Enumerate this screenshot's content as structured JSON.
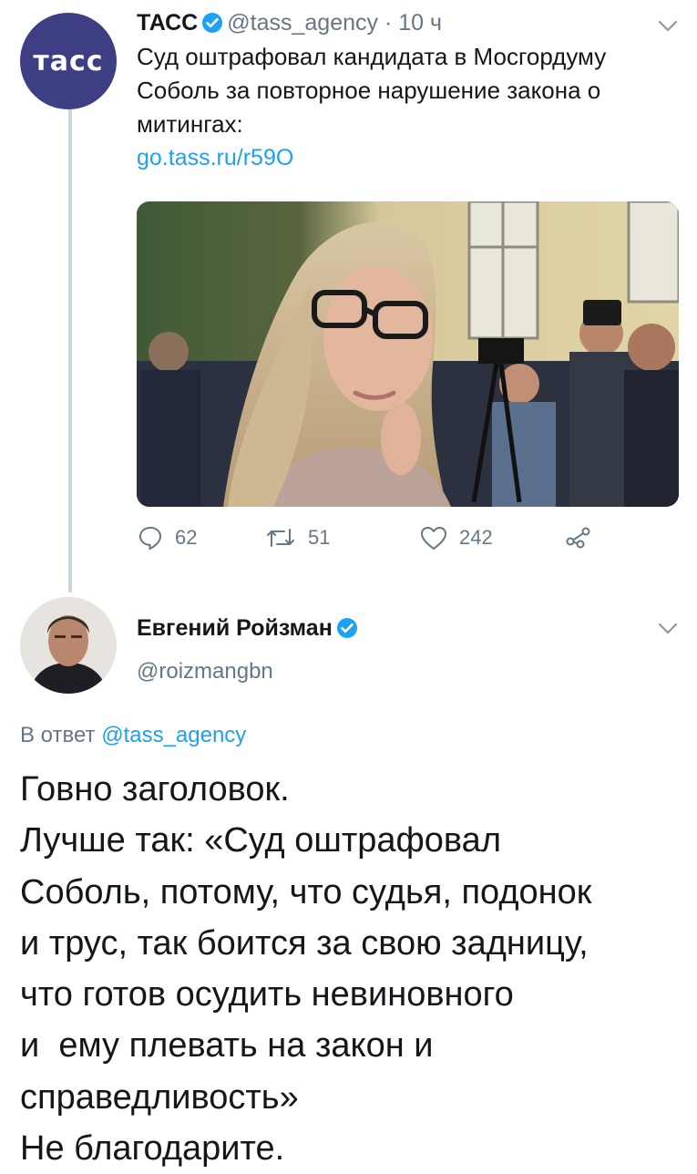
{
  "tweet1": {
    "avatar_text": "тасс",
    "author_name": "ТАСС",
    "handle": "@tass_agency",
    "separator": "·",
    "time": "10 ч",
    "text_lines": [
      "Суд оштрафовал кандидата в Мосгордуму",
      "Соболь за повторное нарушение закона о",
      "митингах:"
    ],
    "link": "go.tass.ru/r59O",
    "actions": {
      "replies": "62",
      "retweets": "51",
      "likes": "242"
    }
  },
  "tweet2": {
    "author_name": "Евгений Ройзман",
    "handle": "@roizmangbn",
    "reply_label": "В ответ",
    "reply_handle": "@tass_agency",
    "body_lines": [
      "Говно заголовок.",
      "Лучше так: «Суд оштрафовал",
      "Соболь, потому, что судья, подонок",
      "и трус, так боится за свою задницу,",
      "что готов осудить невиновного",
      "и  ему плевать на закон и",
      "справедливость»",
      "Не благодарите."
    ]
  },
  "colors": {
    "link": "#1da1f2",
    "secondary_text": "#657786",
    "tass_brand": "#3d3f82",
    "thread_line": "#ccd6dd"
  },
  "icons": [
    "verified-badge-icon",
    "chevron-down-icon",
    "reply-icon",
    "retweet-icon",
    "like-icon",
    "share-icon"
  ]
}
